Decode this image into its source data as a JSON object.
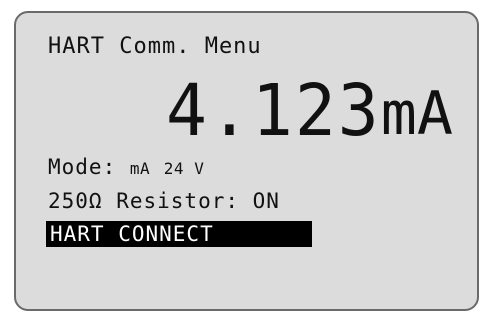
{
  "menu": {
    "title": "HART Comm. Menu"
  },
  "reading": {
    "value": "4.123",
    "unit": "mA"
  },
  "mode": {
    "label": "Mode:",
    "unit": "mA",
    "voltage": "24 V"
  },
  "resistor": {
    "text": "250Ω Resistor: ON"
  },
  "selected_item": {
    "label": "HART CONNECT"
  }
}
